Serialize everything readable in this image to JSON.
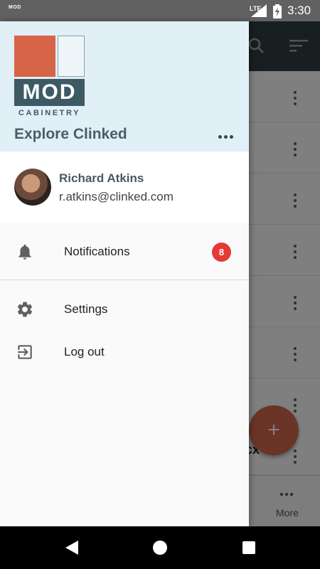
{
  "status_bar": {
    "app_mini": "MOD",
    "network": "LTE",
    "time": "3:30"
  },
  "background": {
    "partial_text": "cx",
    "more_label": "More",
    "fab_label": "+"
  },
  "drawer": {
    "logo": {
      "mark": "MOD",
      "sub": "CABINETRY"
    },
    "workspace_name": "Explore Clinked",
    "user": {
      "name": "Richard Atkins",
      "email": "r.atkins@clinked.com"
    },
    "menu": [
      {
        "label": "Notifications",
        "icon": "bell-icon",
        "badge": "8"
      },
      {
        "label": "Settings",
        "icon": "gear-icon"
      },
      {
        "label": "Log out",
        "icon": "logout-icon"
      }
    ]
  },
  "colors": {
    "header_bg": "#e1eff7",
    "brand_red": "#d76447",
    "brand_slate": "#3d5a64",
    "badge_red": "#e53935"
  }
}
